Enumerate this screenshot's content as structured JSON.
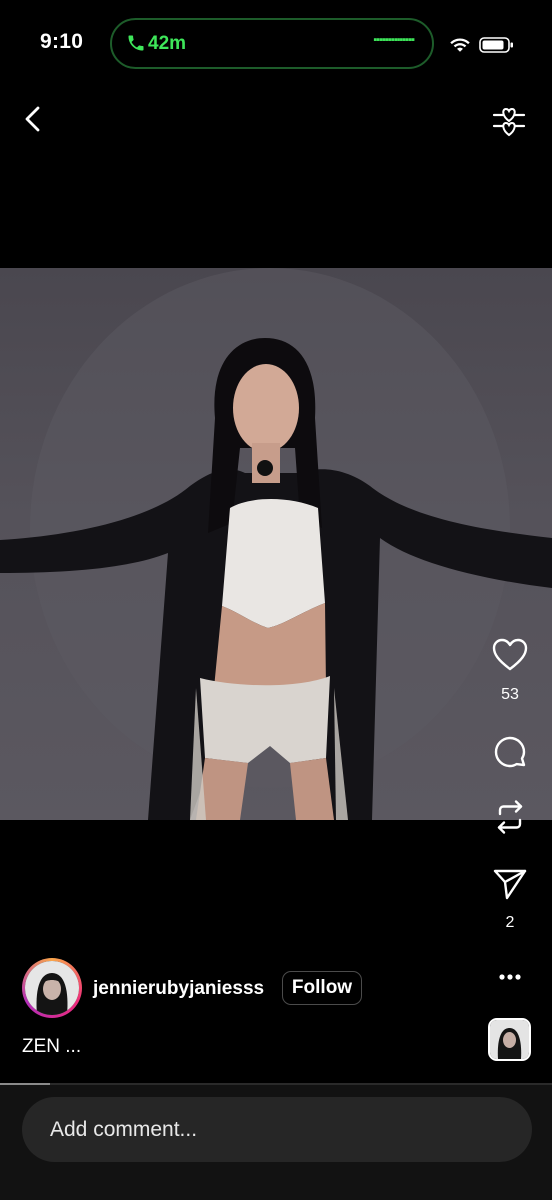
{
  "status_bar": {
    "time": "9:10",
    "call_duration": "42m",
    "call_icon": "phone-icon",
    "wifi_icon": "wifi-icon",
    "battery_icon": "battery-icon",
    "accent_color": "#3ee65a"
  },
  "nav": {
    "back_icon": "chevron-left-icon",
    "filter_icon": "heart-sliders-icon"
  },
  "actions": {
    "like_icon": "heart-outline-icon",
    "like_count": "53",
    "comment_icon": "comment-icon",
    "repost_icon": "repost-icon",
    "share_icon": "send-icon",
    "share_count": "2",
    "more_icon": "more-horizontal-icon"
  },
  "post": {
    "username": "jennierubyjaniesss",
    "follow_label": "Follow",
    "caption": "ZEN ...",
    "video_progress": 0.09
  },
  "comment": {
    "placeholder": "Add comment..."
  }
}
